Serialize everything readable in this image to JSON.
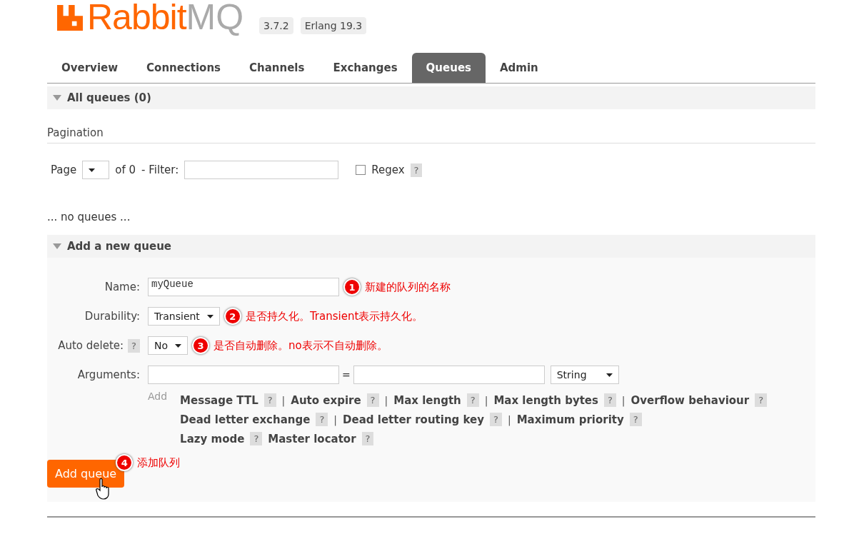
{
  "logo": {
    "part_a": "Rabbit",
    "part_b": "MQ"
  },
  "versions": [
    "3.7.2",
    "Erlang 19.3"
  ],
  "tabs": [
    {
      "label": "Overview",
      "selected": false
    },
    {
      "label": "Connections",
      "selected": false
    },
    {
      "label": "Channels",
      "selected": false
    },
    {
      "label": "Exchanges",
      "selected": false
    },
    {
      "label": "Queues",
      "selected": true
    },
    {
      "label": "Admin",
      "selected": false
    }
  ],
  "all_queues": {
    "title": "All queues (0)",
    "expanded": true,
    "pagination_heading": "Pagination",
    "page_label": "Page",
    "of_label": "of 0",
    "filter_label": "- Filter:",
    "regex_label": "Regex",
    "regex_checked": false,
    "regex_help": "?",
    "empty_text": "... no queues ..."
  },
  "add_queue": {
    "title": "Add a new queue",
    "expanded": true,
    "fields": [
      {
        "kind": "text",
        "label": "Name:",
        "value": "myQueue",
        "annotation": {
          "number": "1",
          "text": "新建的队列的名称"
        }
      },
      {
        "kind": "select",
        "label": "Durability:",
        "value": "Transient",
        "annotation": {
          "number": "2",
          "text": "是否持久化。Transient表示持久化。"
        }
      },
      {
        "kind": "select",
        "label": "Auto delete:",
        "help": "?",
        "value": "No",
        "annotation": {
          "number": "3",
          "text": "是否自动删除。no表示不自动删除。"
        }
      }
    ],
    "arguments": {
      "label": "Arguments:",
      "equals": "=",
      "type_value": "String",
      "add_label": "Add",
      "shortcut_rows": [
        [
          {
            "label": "Message TTL",
            "help": "?",
            "separator_after": "|"
          },
          {
            "label": "Auto expire",
            "help": "?",
            "separator_after": "|"
          },
          {
            "label": "Max length",
            "help": "?",
            "separator_after": "|"
          },
          {
            "label": "Max length bytes",
            "help": "?",
            "separator_after": "|"
          },
          {
            "label": "Overflow behaviour",
            "help": "?"
          }
        ],
        [
          {
            "label": "Dead letter exchange",
            "help": "?",
            "separator_after": "|"
          },
          {
            "label": "Dead letter routing key",
            "help": "?",
            "separator_after": "|"
          },
          {
            "label": "Maximum priority",
            "help": "?"
          }
        ],
        [
          {
            "label": "Lazy mode",
            "help": "?"
          },
          {
            "label": "Master locator",
            "help": "?"
          }
        ]
      ]
    },
    "button": {
      "label": "Add queue",
      "annotation": {
        "number": "4",
        "text": "添加队列"
      }
    }
  }
}
